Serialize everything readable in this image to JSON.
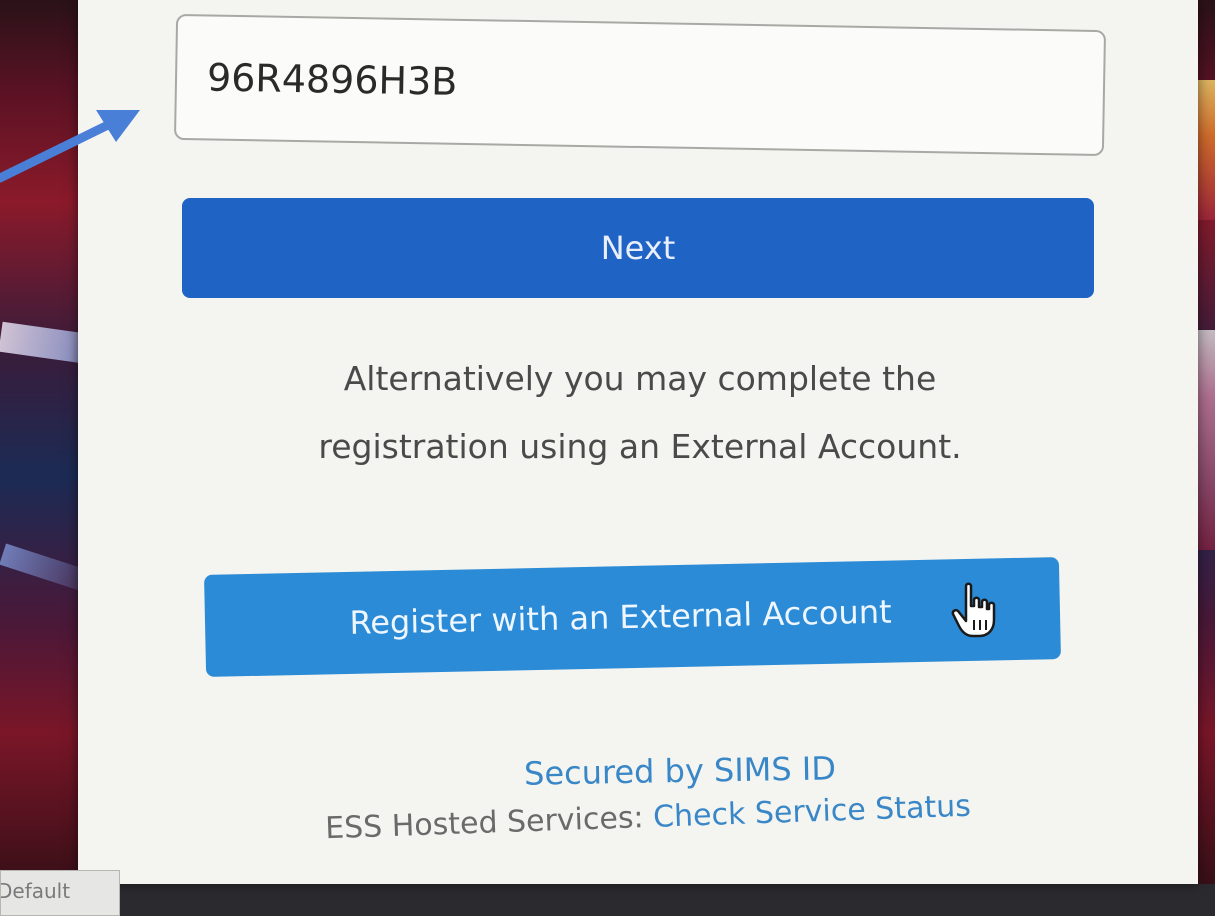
{
  "form": {
    "code_value": "96R4896H3B",
    "next_label": "Next",
    "alternative_text": "Alternatively you may complete the registration using an External Account.",
    "external_label": "Register with an External Account"
  },
  "footer": {
    "secured_text": "Secured by SIMS ID",
    "ess_prefix": "ESS Hosted Services:",
    "ess_link": "Check Service Status"
  },
  "taskbar": {
    "default_tab_label": "Default"
  },
  "icons": {
    "cursor": "hand-pointer-icon",
    "annotation": "blue-arrow-icon"
  },
  "colors": {
    "next_button": "#1f63c4",
    "external_button": "#2b8bd6",
    "link": "#3a87c8",
    "annotation_arrow": "#4a7fd8"
  }
}
